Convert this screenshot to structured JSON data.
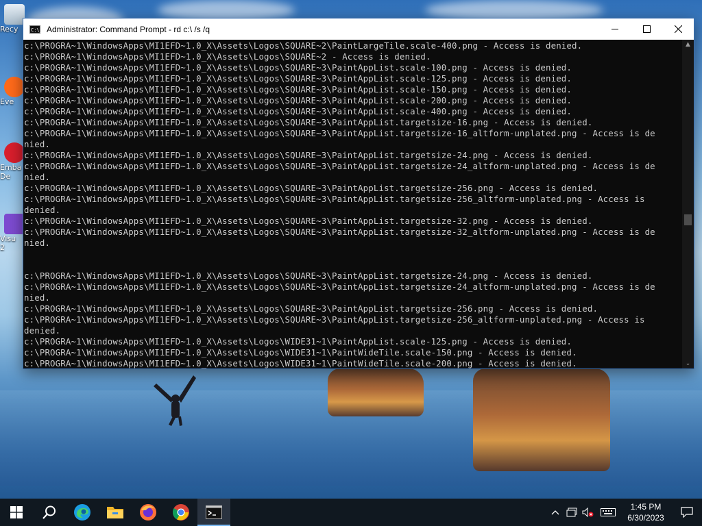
{
  "window": {
    "title": "Administrator:  Command Prompt - rd  c:\\ /s /q",
    "app_icon_text": "C:\\_"
  },
  "console_lines": [
    "c:\\PROGRA~1\\WindowsApps\\MI1EFD~1.0_X\\Assets\\Logos\\SQUARE~2\\PaintLargeTile.scale-400.png - Access is denied.",
    "c:\\PROGRA~1\\WindowsApps\\MI1EFD~1.0_X\\Assets\\Logos\\SQUARE~2 - Access is denied.",
    "c:\\PROGRA~1\\WindowsApps\\MI1EFD~1.0_X\\Assets\\Logos\\SQUARE~3\\PaintAppList.scale-100.png - Access is denied.",
    "c:\\PROGRA~1\\WindowsApps\\MI1EFD~1.0_X\\Assets\\Logos\\SQUARE~3\\PaintAppList.scale-125.png - Access is denied.",
    "c:\\PROGRA~1\\WindowsApps\\MI1EFD~1.0_X\\Assets\\Logos\\SQUARE~3\\PaintAppList.scale-150.png - Access is denied.",
    "c:\\PROGRA~1\\WindowsApps\\MI1EFD~1.0_X\\Assets\\Logos\\SQUARE~3\\PaintAppList.scale-200.png - Access is denied.",
    "c:\\PROGRA~1\\WindowsApps\\MI1EFD~1.0_X\\Assets\\Logos\\SQUARE~3\\PaintAppList.scale-400.png - Access is denied.",
    "c:\\PROGRA~1\\WindowsApps\\MI1EFD~1.0_X\\Assets\\Logos\\SQUARE~3\\PaintAppList.targetsize-16.png - Access is denied.",
    "c:\\PROGRA~1\\WindowsApps\\MI1EFD~1.0_X\\Assets\\Logos\\SQUARE~3\\PaintAppList.targetsize-16_altform-unplated.png - Access is de",
    "nied.",
    "c:\\PROGRA~1\\WindowsApps\\MI1EFD~1.0_X\\Assets\\Logos\\SQUARE~3\\PaintAppList.targetsize-24.png - Access is denied.",
    "c:\\PROGRA~1\\WindowsApps\\MI1EFD~1.0_X\\Assets\\Logos\\SQUARE~3\\PaintAppList.targetsize-24_altform-unplated.png - Access is de",
    "nied.",
    "c:\\PROGRA~1\\WindowsApps\\MI1EFD~1.0_X\\Assets\\Logos\\SQUARE~3\\PaintAppList.targetsize-256.png - Access is denied.",
    "c:\\PROGRA~1\\WindowsApps\\MI1EFD~1.0_X\\Assets\\Logos\\SQUARE~3\\PaintAppList.targetsize-256_altform-unplated.png - Access is",
    "denied.",
    "c:\\PROGRA~1\\WindowsApps\\MI1EFD~1.0_X\\Assets\\Logos\\SQUARE~3\\PaintAppList.targetsize-32.png - Access is denied.",
    "c:\\PROGRA~1\\WindowsApps\\MI1EFD~1.0_X\\Assets\\Logos\\SQUARE~3\\PaintAppList.targetsize-32_altform-unplated.png - Access is de",
    "nied.",
    "",
    "",
    "c:\\PROGRA~1\\WindowsApps\\MI1EFD~1.0_X\\Assets\\Logos\\SQUARE~3\\PaintAppList.targetsize-24.png - Access is denied.",
    "c:\\PROGRA~1\\WindowsApps\\MI1EFD~1.0_X\\Assets\\Logos\\SQUARE~3\\PaintAppList.targetsize-24_altform-unplated.png - Access is de",
    "nied.",
    "c:\\PROGRA~1\\WindowsApps\\MI1EFD~1.0_X\\Assets\\Logos\\SQUARE~3\\PaintAppList.targetsize-256.png - Access is denied.",
    "c:\\PROGRA~1\\WindowsApps\\MI1EFD~1.0_X\\Assets\\Logos\\SQUARE~3\\PaintAppList.targetsize-256_altform-unplated.png - Access is",
    "denied.",
    "c:\\PROGRA~1\\WindowsApps\\MI1EFD~1.0_X\\Assets\\Logos\\WIDE31~1\\PaintAppList.scale-125.png - Access is denied.",
    "c:\\PROGRA~1\\WindowsApps\\MI1EFD~1.0_X\\Assets\\Logos\\WIDE31~1\\PaintWideTile.scale-150.png - Access is denied.",
    "c:\\PROGRA~1\\WindowsApps\\MI1EFD~1.0_X\\Assets\\Logos\\WIDE31~1\\PaintWideTile.scale-200.png - Access is denied."
  ],
  "desktop_icons": [
    {
      "label": "Recy",
      "icon": "recycle-bin-icon"
    },
    {
      "label": "Eve",
      "icon": "shortcut-icon"
    },
    {
      "label": "Emba\nDe",
      "icon": "shortcut-icon"
    },
    {
      "label": "Visu\n2",
      "icon": "visual-studio-icon"
    }
  ],
  "taskbar": {
    "items": [
      {
        "name": "start-button",
        "icon": "windows-logo-icon"
      },
      {
        "name": "search-button",
        "icon": "search-icon"
      },
      {
        "name": "edge-button",
        "icon": "edge-icon"
      },
      {
        "name": "file-explorer-button",
        "icon": "folder-icon"
      },
      {
        "name": "firefox-button",
        "icon": "firefox-icon"
      },
      {
        "name": "chrome-button",
        "icon": "chrome-icon"
      },
      {
        "name": "command-prompt-button",
        "icon": "terminal-icon",
        "active": true
      }
    ],
    "clock": {
      "time": "1:45 PM",
      "date": "6/30/2023"
    },
    "tray_icons": [
      "chevron-up-icon",
      "network-icon",
      "volume-muted-icon",
      "keyboard-icon",
      "notification-icon"
    ]
  },
  "colors": {
    "console_bg": "#0c0c0c",
    "console_text": "#cccccc",
    "taskbar_bg": "#101820",
    "active_indicator": "#79b8f3"
  }
}
